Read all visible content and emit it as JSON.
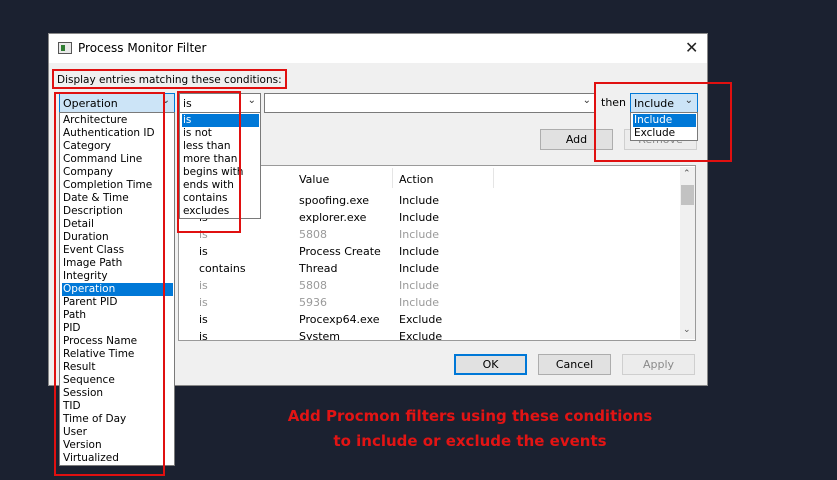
{
  "window": {
    "title": "Process Monitor Filter",
    "close_glyph": "✕"
  },
  "conditions_label": "Display entries matching these conditions:",
  "column_combo": {
    "value": "Operation"
  },
  "relation_combo": {
    "value": "is"
  },
  "value_combo": {
    "value": ""
  },
  "then_label": "then",
  "action_combo": {
    "value": "Include"
  },
  "buttons": {
    "add": "Add",
    "remove": "Remove",
    "ok": "OK",
    "cancel": "Cancel",
    "apply": "Apply"
  },
  "column_options": [
    "Architecture",
    "Authentication ID",
    "Category",
    "Command Line",
    "Company",
    "Completion Time",
    "Date & Time",
    "Description",
    "Detail",
    "Duration",
    "Event Class",
    "Image Path",
    "Integrity",
    "Operation",
    "Parent PID",
    "Path",
    "PID",
    "Process Name",
    "Relative Time",
    "Result",
    "Sequence",
    "Session",
    "TID",
    "Time of Day",
    "User",
    "Version",
    "Virtualized"
  ],
  "column_selected": "Operation",
  "relation_options": [
    "is",
    "is not",
    "less than",
    "more than",
    "begins with",
    "ends with",
    "contains",
    "excludes"
  ],
  "relation_selected": "is",
  "action_options": [
    "Include",
    "Exclude"
  ],
  "action_selected": "Include",
  "grid": {
    "headers": {
      "value": "Value",
      "action": "Action"
    },
    "rows": [
      {
        "relation": "is",
        "value": "spoofing.exe",
        "action": "Include",
        "enabled": true
      },
      {
        "relation": "is",
        "value": "explorer.exe",
        "action": "Include",
        "enabled": true
      },
      {
        "relation": "is",
        "value": "5808",
        "action": "Include",
        "enabled": false
      },
      {
        "relation": "is",
        "value": "Process Create",
        "action": "Include",
        "enabled": true
      },
      {
        "relation": "contains",
        "value": "Thread",
        "action": "Include",
        "enabled": true
      },
      {
        "relation": "is",
        "value": "5808",
        "action": "Include",
        "enabled": false
      },
      {
        "relation": "is",
        "value": "5936",
        "action": "Include",
        "enabled": false
      },
      {
        "relation": "is",
        "value": "Procexp64.exe",
        "action": "Exclude",
        "enabled": true
      },
      {
        "relation": "is",
        "value": "System",
        "action": "Exclude",
        "enabled": true
      }
    ]
  },
  "caption": {
    "line1": "Add Procmon filters using these conditions",
    "line2": "to include or exclude the events"
  },
  "colors": {
    "highlight": "#e01010",
    "selection": "#0078d7",
    "background": "#1b2130"
  }
}
